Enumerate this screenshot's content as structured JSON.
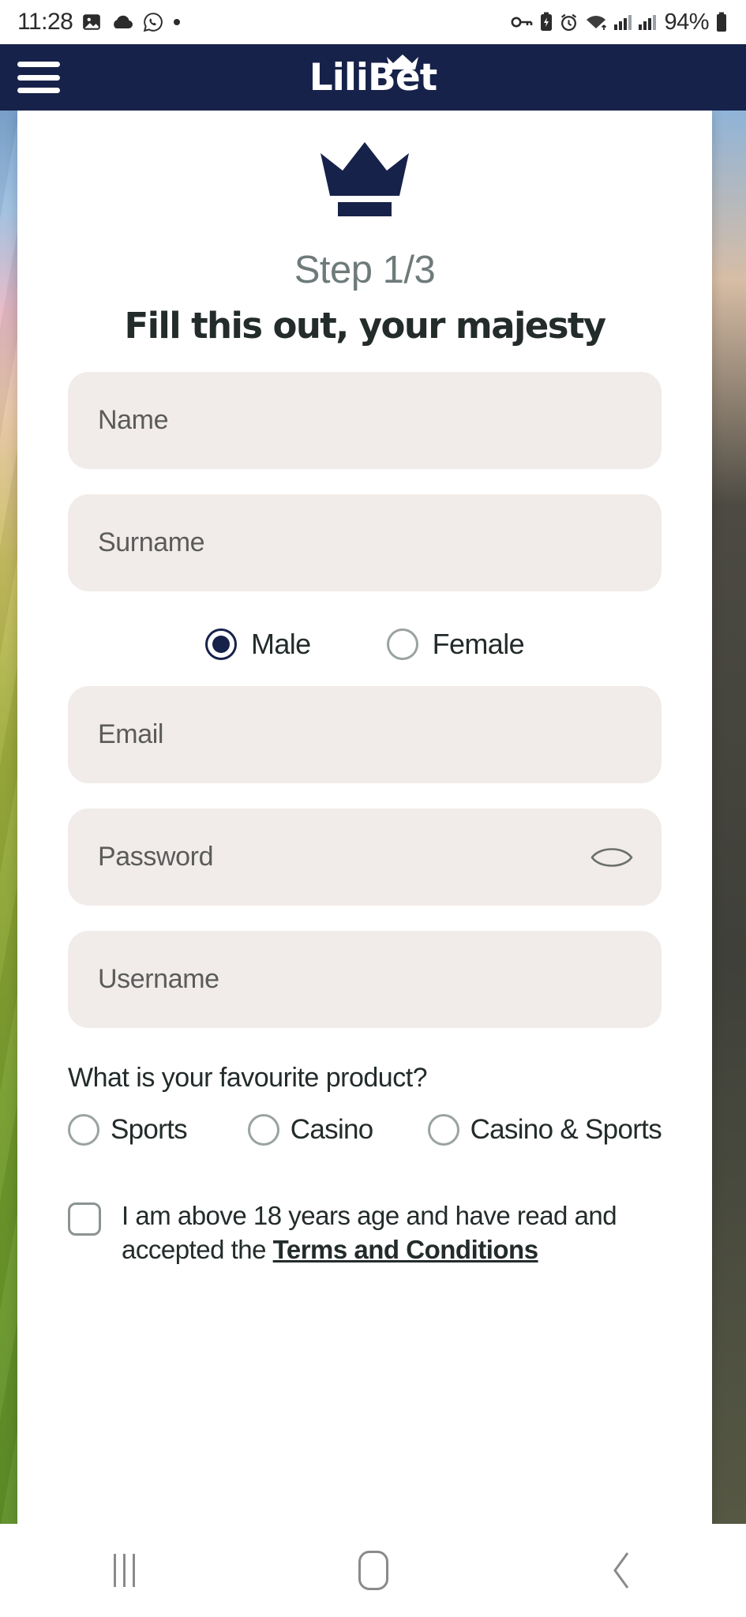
{
  "status_bar": {
    "time": "11:28",
    "left_icons": [
      "photo-icon",
      "cloud-icon",
      "whatsapp-icon",
      "dot-icon"
    ],
    "right_icons": [
      "vpn-key-icon",
      "battery-saver-icon",
      "alarm-icon",
      "wifi-icon",
      "signal-icon-1",
      "signal-icon-2"
    ],
    "battery_percent": "94%"
  },
  "header": {
    "menu_icon": "hamburger-icon",
    "brand": "LiliBet",
    "crown_icon": "crown-icon",
    "background_color": "#17224a"
  },
  "modal": {
    "crown_icon": "crown-icon",
    "step": "Step 1/3",
    "headline": "Fill this out, your majesty",
    "fields": [
      {
        "name": "name",
        "placeholder": "Name",
        "value": ""
      },
      {
        "name": "surname",
        "placeholder": "Surname",
        "value": ""
      },
      {
        "name": "email",
        "placeholder": "Email",
        "value": ""
      },
      {
        "name": "password",
        "placeholder": "Password",
        "value": "",
        "toggle_icon": "eye-icon"
      },
      {
        "name": "username",
        "placeholder": "Username",
        "value": ""
      }
    ],
    "gender": {
      "options": [
        {
          "label": "Male",
          "selected": true
        },
        {
          "label": "Female",
          "selected": false
        }
      ]
    },
    "favourite_product": {
      "question": "What is your favourite product?",
      "options": [
        {
          "label": "Sports",
          "selected": false
        },
        {
          "label": "Casino",
          "selected": false
        },
        {
          "label": "Casino & Sports",
          "selected": false
        }
      ]
    },
    "terms": {
      "checked": false,
      "text_before": "I am above 18 years age and have read and accepted the ",
      "link": "Terms and Conditions"
    },
    "accent_color": "#17224a",
    "field_background": "#f1ece9"
  },
  "nav_bar": {
    "recents_icon": "recents-icon",
    "home_icon": "home-icon",
    "back_icon": "back-chevron-icon"
  }
}
